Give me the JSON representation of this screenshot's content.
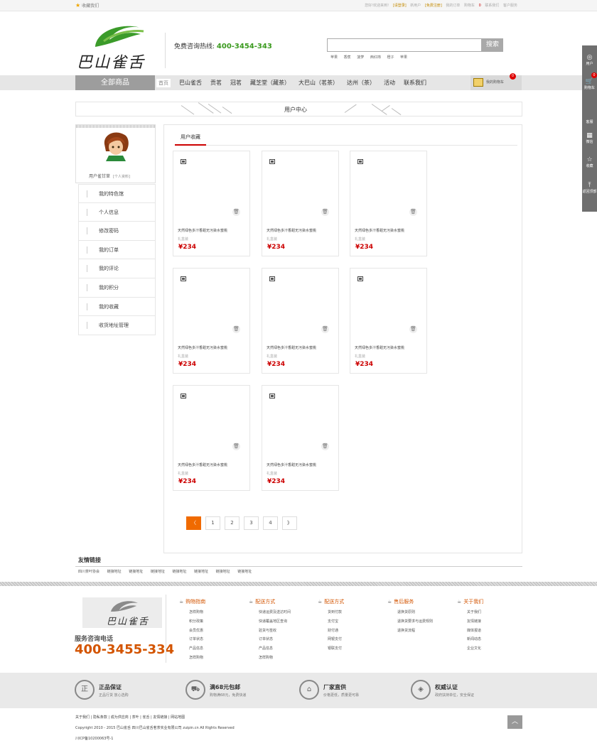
{
  "topbar": {
    "favorite": "收藏我们",
    "links": [
      "您好!欢迎来到!",
      "[请登录]",
      "新用户",
      "[免费注册]",
      "我的订单",
      "购物车",
      "0",
      "联系我们",
      "客户服务"
    ]
  },
  "header": {
    "logo_text": "巴山雀舌",
    "hotline_label": "免费咨询热线: ",
    "hotline_number": "400-3454-343",
    "search_placeholder": "",
    "search_button": "搜索",
    "hot_words": [
      "苹果",
      "香蕉",
      "菠萝",
      "西红柿",
      "橙子",
      "苹果"
    ]
  },
  "nav": {
    "all_goods": "全部商品",
    "home": "首页",
    "items": [
      "巴山雀舌",
      "贡茗",
      "冠茗",
      "藏芝堂（藏茶）",
      "大巴山（茗茶）",
      "达州（茶）",
      "活动",
      "联系我们"
    ],
    "cart": "我的购物车",
    "cart_count": "0"
  },
  "section": {
    "title": "用户中心"
  },
  "user": {
    "name": "用户雀甘草",
    "profile_link": "[个人资料]"
  },
  "menu": [
    "我的特色馆",
    "个人信息",
    "修改密码",
    "我的订单",
    "我的评论",
    "我的积分",
    "我的收藏",
    "收货地址管理"
  ],
  "tab": "用户收藏",
  "products": [
    {
      "name": "天然绿色多汁香甜无污染水蜜桃",
      "sub": "礼盒装",
      "price": "¥234"
    },
    {
      "name": "天然绿色多汁香甜无污染水蜜桃",
      "sub": "礼盒装",
      "price": "¥234"
    },
    {
      "name": "天然绿色多汁香甜无污染水蜜桃",
      "sub": "礼盒装",
      "price": "¥234"
    },
    {
      "name": "天然绿色多汁香甜无污染水蜜桃",
      "sub": "礼盒装",
      "price": "¥234"
    },
    {
      "name": "天然绿色多汁香甜无污染水蜜桃",
      "sub": "礼盒装",
      "price": "¥234"
    },
    {
      "name": "天然绿色多汁香甜无污染水蜜桃",
      "sub": "礼盒装",
      "price": "¥234"
    },
    {
      "name": "天然绿色多汁香甜无污染水蜜桃",
      "sub": "礼盒装",
      "price": "¥234"
    },
    {
      "name": "天然绿色多汁香甜无污染水蜜桃",
      "sub": "礼盒装",
      "price": "¥234"
    }
  ],
  "pager": [
    "〈",
    "1",
    "2",
    "3",
    "4",
    "》"
  ],
  "friend_links": {
    "title": "友情链接",
    "items": [
      "四川茶叶协会",
      "链接地址",
      "链接地址",
      "链接地址",
      "链接地址",
      "链接地址",
      "链接地址",
      "链接地址"
    ]
  },
  "footer": {
    "logo_text": "巴山雀舌",
    "consult_label": "服务咨询电话",
    "consult_number": "400-3455-334",
    "columns": [
      {
        "title": "购物指南",
        "items": [
          "怎样购物",
          "积分政策",
          "会员优惠",
          "订单状态",
          "产品信息",
          "怎样购物"
        ]
      },
      {
        "title": "配送方式",
        "items": [
          "快递运费及送达时间",
          "快递覆盖地区查询",
          "验货与签收",
          "订单状态",
          "产品信息",
          "怎样购物"
        ]
      },
      {
        "title": "配送方式",
        "items": [
          "货到付款",
          "支付宝",
          "财付通",
          "网银支付",
          "银联支付"
        ]
      },
      {
        "title": "售后服务",
        "items": [
          "退换货原则",
          "退换货要求与运费规则",
          "退换货流程"
        ]
      },
      {
        "title": "关于我们",
        "items": [
          "关于我们",
          "友情链接",
          "媒体报道",
          "新闻动态",
          "企业文化"
        ]
      }
    ],
    "guarantees": [
      {
        "icon": "正",
        "title": "正品保证",
        "desc": "正品行货 放心选购"
      },
      {
        "icon": "bus",
        "title": "满68元包邮",
        "desc": "购物满68元，免费快递"
      },
      {
        "icon": "factory",
        "title": "厂家直供",
        "desc": "价格更低，质量更可靠"
      },
      {
        "icon": "shield",
        "title": "权威认证",
        "desc": "政府扶持单位，安全保证"
      }
    ],
    "bottom_links": "关于我们 | 隐私条款 | 成为供应商 | 茶叶 | 雀舌 | 友情链接 | 网站地图",
    "copyright": "Copyright 2010 - 2015 巴山雀舌 四川巴山雀舌茗茶实业有限公司 zuipin.cn All Rights Reserved",
    "icp": "川ICP备10200063号-1"
  },
  "right_bar": {
    "items": [
      "用户",
      "购物车",
      "客服",
      "微信",
      "收藏",
      "返回顶部"
    ],
    "cart_count": "0"
  },
  "colors": {
    "accent": "#c00000",
    "orange": "#f06a00",
    "green": "#3a9a1e",
    "footer_number": "#d35400"
  }
}
